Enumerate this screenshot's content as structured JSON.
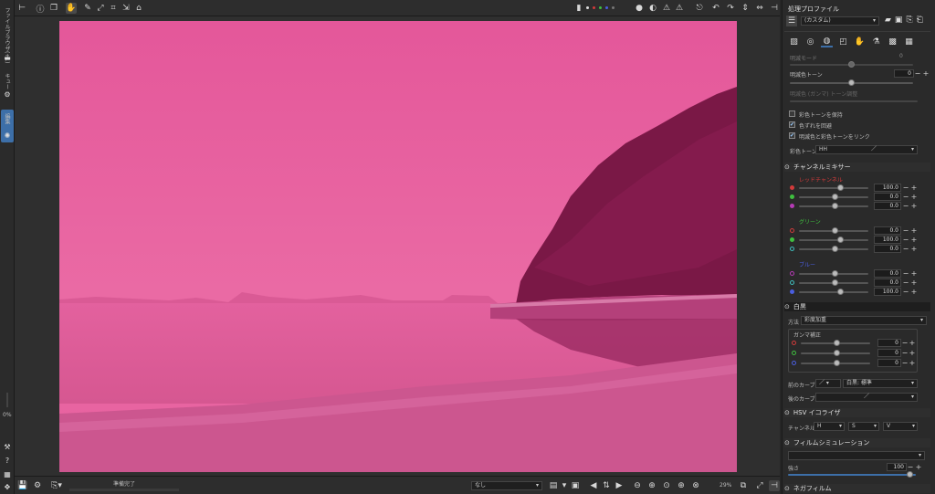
{
  "left_strip": {
    "file_browser_label": "ファイルブラウザ(+1)",
    "queue_label": "キュー",
    "editor_label": "編集",
    "zoom_value": "0%"
  },
  "canvas": {
    "photo_tint": "#e55a97",
    "status_text": "準備完了"
  },
  "bottom": {
    "color_profile_value": "なし",
    "zoom_percent": "29%"
  },
  "profile": {
    "header": "処理プロファイル",
    "value": "(カスタム)"
  },
  "bw": {
    "row1_label": "明滅モード",
    "row1_value": "0",
    "tone_label": "明滅色トーン",
    "tone_value": "0",
    "tone_curve_label": "明滅色 (ガンマ) トーン調整",
    "cb_keep": "彩色トーンを保持",
    "cb_balance": "色ずれを回避",
    "cb_sat": "明滅色と彩色トーンをリンク",
    "method_label": "彩色トーン",
    "method_value": "HH"
  },
  "channel_mixer": {
    "title": "チャンネルミキサー",
    "red_label": "レッドチャンネル",
    "green_label": "グリーン",
    "blue_label": "ブルー",
    "red": [
      "100.0",
      "0.0",
      "0.0"
    ],
    "green": [
      "0.0",
      "100.0",
      "0.0"
    ],
    "blue": [
      "0.0",
      "0.0",
      "100.0"
    ]
  },
  "white_black": {
    "title": "白黒",
    "method_label": "方法",
    "method_value": "彩度加重",
    "gamma_label": "ガンマ補正",
    "gamma": [
      "0",
      "0",
      "0"
    ],
    "before_curve_label": "前のカーブ",
    "before_curve_value": "白黒: 標準",
    "after_curve_label": "後のカーブ"
  },
  "hsv": {
    "title": "HSV イコライザ",
    "channel_label": "チャンネル",
    "h": "H",
    "s": "S",
    "v": "V"
  },
  "film": {
    "title": "フィルムシミュレーション",
    "strength_label": "強さ",
    "strength_value": "100"
  },
  "negative": {
    "title": "ネガフィルム"
  },
  "colors": {
    "accent_blue": "#3d6fa8",
    "red": "#d23b3b",
    "green": "#3fbf3f",
    "blue": "#4a5ee0"
  }
}
